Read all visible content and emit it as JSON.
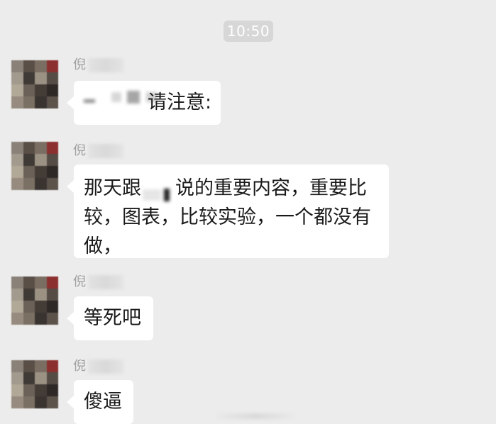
{
  "timestamp": "10:50",
  "messages": [
    {
      "sender": "倪",
      "text_parts": [
        "请注意:"
      ]
    },
    {
      "sender": "倪",
      "text_parts": [
        "那天跟",
        "说的重要内容，重要比较，图表，比较实验，一个都没有做，"
      ]
    },
    {
      "sender": "倪",
      "text_parts": [
        "等死吧"
      ]
    },
    {
      "sender": "倪",
      "text_parts": [
        "傻逼"
      ]
    }
  ],
  "colors": {
    "background": "#ececec",
    "bubble": "#ffffff",
    "time_pill": "#d7d7d7",
    "sender_text": "#a0a0a0",
    "message_text": "#1a1a1a"
  }
}
